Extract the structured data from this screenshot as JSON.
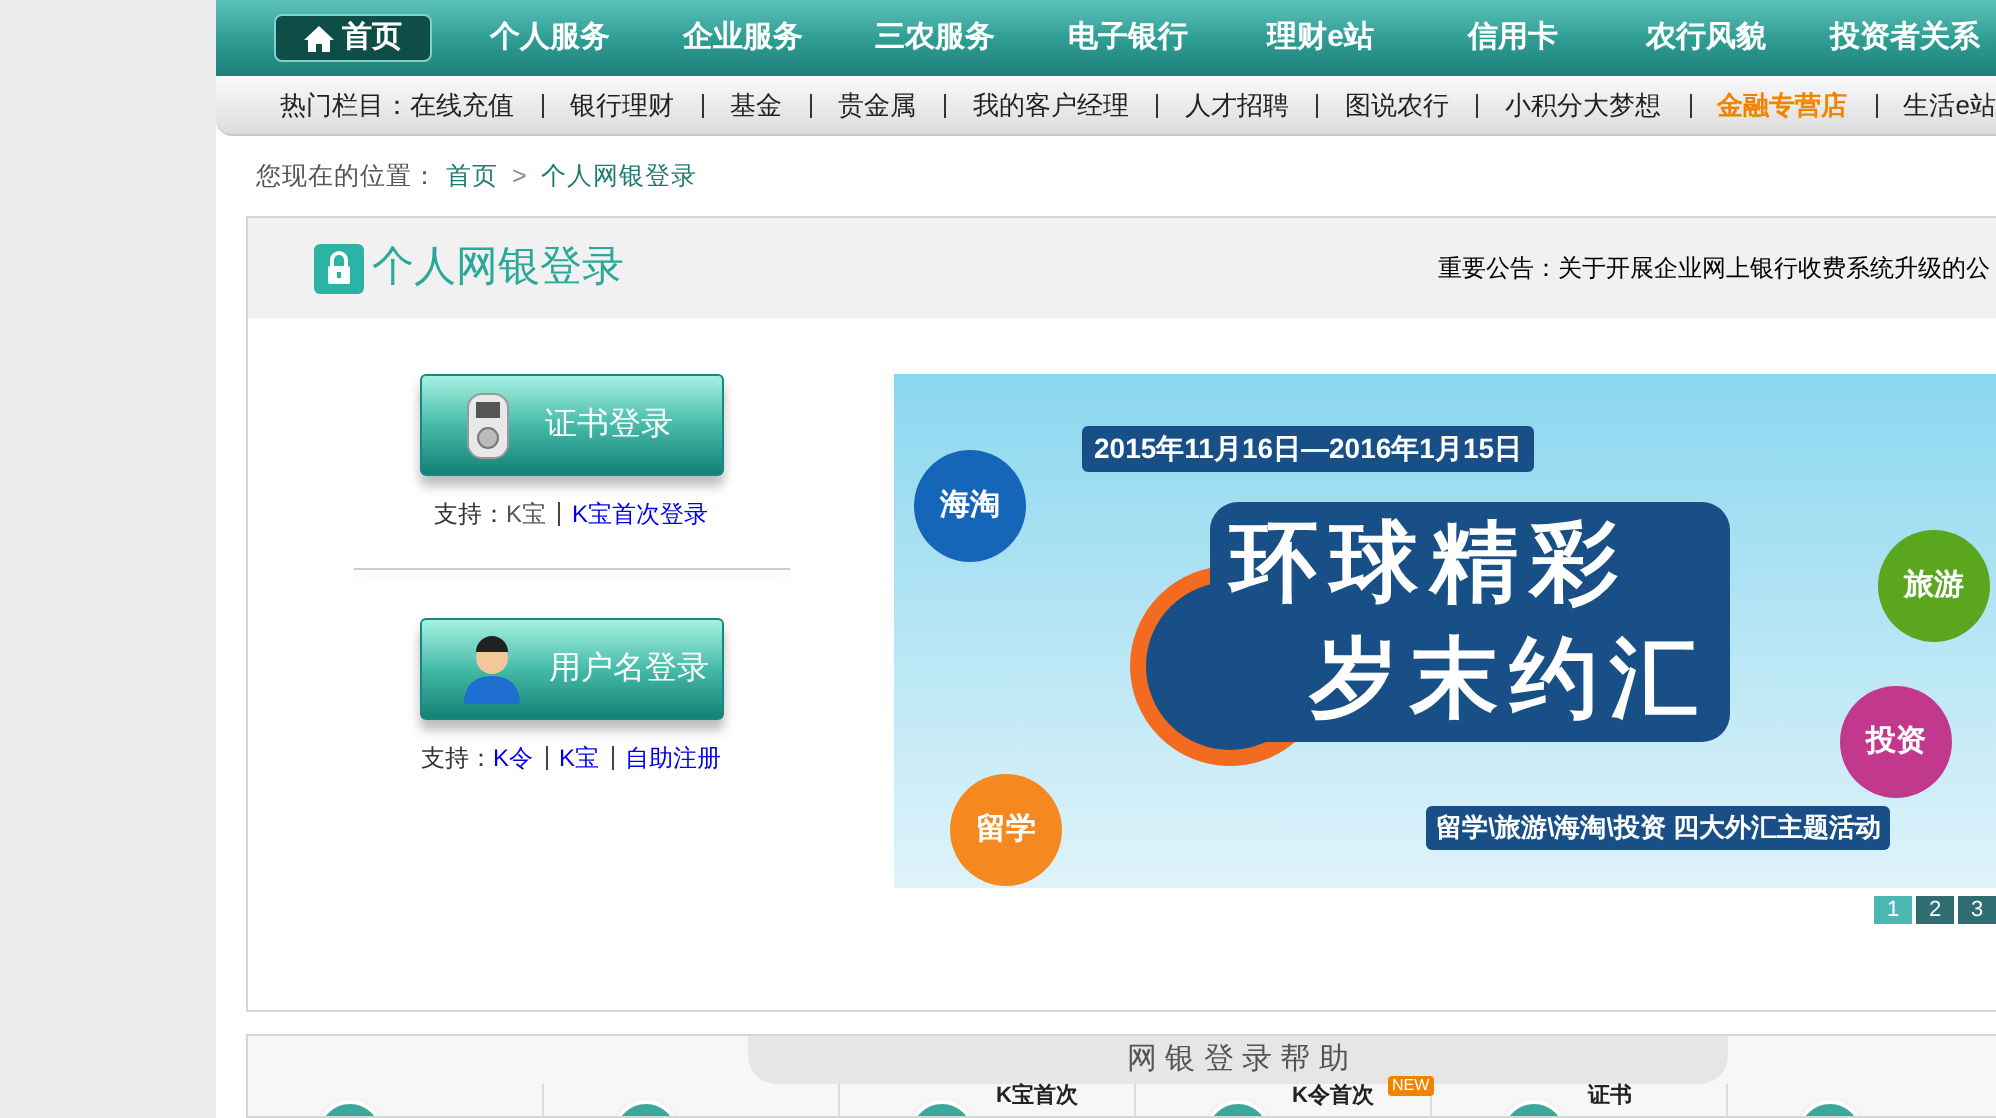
{
  "main_nav": [
    {
      "label": "首页",
      "selected": true
    },
    {
      "label": "个人服务",
      "selected": false
    },
    {
      "label": "企业服务",
      "selected": false
    },
    {
      "label": "三农服务",
      "selected": false
    },
    {
      "label": "电子银行",
      "selected": false
    },
    {
      "label": "理财e站",
      "selected": false
    },
    {
      "label": "信用卡",
      "selected": false
    },
    {
      "label": "农行风貌",
      "selected": false
    },
    {
      "label": "投资者关系",
      "selected": false
    }
  ],
  "hot_bar": {
    "label": "热门栏目：",
    "items": [
      {
        "label": "在线充值",
        "highlighted": false
      },
      {
        "label": "银行理财",
        "highlighted": false
      },
      {
        "label": "基金",
        "highlighted": false
      },
      {
        "label": "贵金属",
        "highlighted": false
      },
      {
        "label": "我的客户经理",
        "highlighted": false
      },
      {
        "label": "人才招聘",
        "highlighted": false
      },
      {
        "label": "图说农行",
        "highlighted": false
      },
      {
        "label": "小积分大梦想",
        "highlighted": false
      },
      {
        "label": "金融专营店",
        "highlighted": true
      },
      {
        "label": "生活e站",
        "highlighted": false
      }
    ]
  },
  "breadcrumb": {
    "label": "您现在的位置：",
    "items": [
      "首页",
      "个人网银登录"
    ],
    "separator": ">"
  },
  "panel": {
    "title": "个人网银登录",
    "notice": "重要公告：关于开展企业网上银行收费系统升级的公"
  },
  "logins": [
    {
      "kind": "certificate",
      "label": "证书登录",
      "support_label": "支持：",
      "support": [
        {
          "text": "K宝",
          "link": false
        },
        {
          "text": "K宝首次登录",
          "link": true
        }
      ]
    },
    {
      "kind": "user",
      "label": "用户名登录",
      "support_label": "支持：",
      "support": [
        {
          "text": "K令",
          "link": true
        },
        {
          "text": "K宝",
          "link": true
        },
        {
          "text": "自助注册",
          "link": true
        }
      ]
    }
  ],
  "banner": {
    "date": "2015年11月16日—2016年1月15日",
    "title_lines": [
      "环球精彩",
      "岁末约汇"
    ],
    "tags": [
      {
        "text": "海淘",
        "color": "#1565b8"
      },
      {
        "text": "旅游",
        "color": "#5aa61e"
      },
      {
        "text": "投资",
        "color": "#c2388c"
      },
      {
        "text": "留学",
        "color": "#f5891f"
      }
    ],
    "subtitle": "留学\\旅游\\海淘\\投资 四大外汇主题活动"
  },
  "pager": [
    {
      "label": "1",
      "selected": true
    },
    {
      "label": "2",
      "selected": false
    },
    {
      "label": "3",
      "selected": false
    }
  ],
  "help": {
    "title": "网 银 登 录 帮 助",
    "items": [
      {
        "kind": "icon"
      },
      {
        "kind": "icon"
      },
      {
        "kind": "labeled",
        "label": "K宝首次"
      },
      {
        "kind": "labeled",
        "label": "K令首次",
        "badge": "NEW"
      },
      {
        "kind": "labeled",
        "label": "证书"
      },
      {
        "kind": "icon"
      }
    ]
  }
}
